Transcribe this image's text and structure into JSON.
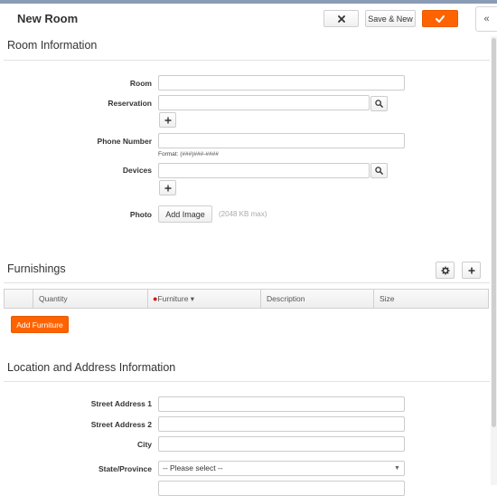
{
  "header": {
    "title": "New Room",
    "cancel_icon": "close-icon",
    "save_new_label": "Save & New",
    "save_icon": "checkmark-icon",
    "collapse_icon": "double-chevron-left-icon",
    "collapse_glyph": "«"
  },
  "room_info": {
    "section_title": "Room Information",
    "room_label": "Room",
    "room_value": "",
    "reservation_label": "Reservation",
    "reservation_value": "",
    "phone_label": "Phone Number",
    "phone_value": "",
    "phone_format": "Format: (###)###-####",
    "devices_label": "Devices",
    "devices_value": "",
    "photo_label": "Photo",
    "add_image_label": "Add Image",
    "image_limit": "(2048 KB max)"
  },
  "furnishings": {
    "section_title": "Furnishings",
    "columns": [
      "Quantity",
      "Furniture ▾",
      "Description",
      "Size"
    ],
    "add_label": "Add Furniture"
  },
  "location": {
    "section_title": "Location and Address Information",
    "street1_label": "Street Address 1",
    "street1_value": "",
    "street2_label": "Street Address 2",
    "street2_value": "",
    "city_label": "City",
    "city_value": "",
    "state_label": "State/Province",
    "state_value": "-- Please select --"
  },
  "colors": {
    "accent": "#ff6300",
    "required": "#e40000"
  }
}
